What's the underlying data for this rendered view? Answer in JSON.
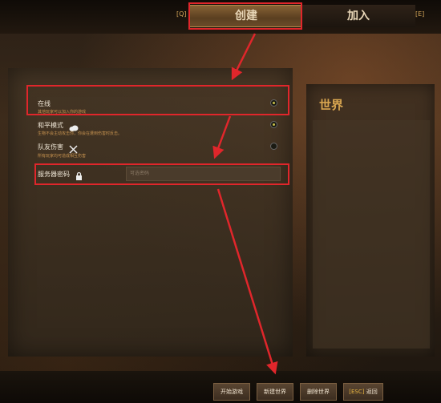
{
  "header": {
    "create_key": "[Q]",
    "join_key": "[E]",
    "tabs": [
      {
        "label": "创建",
        "active": true
      },
      {
        "label": "加入",
        "active": false
      }
    ]
  },
  "options": [
    {
      "label": "在线",
      "desc": "其他玩家可以加入你的游戏",
      "selected": true,
      "icon": ""
    },
    {
      "label": "和平模式",
      "desc": "生物不会主动攻击你，你会在遭到伤害时反击。",
      "selected": true,
      "icon": "cloud-icon"
    },
    {
      "label": "队友伤害",
      "desc": "所有玩家均可造成相互伤害",
      "selected": false,
      "icon": "crossed-swords-icon"
    }
  ],
  "password": {
    "label": "服务器密码",
    "icon": "lock-icon",
    "value": "可选密码"
  },
  "world_panel": {
    "title": "世界"
  },
  "bottom_buttons": [
    {
      "label": "开始游戏"
    },
    {
      "label": "新建世界"
    },
    {
      "label": "删除世界"
    },
    {
      "key": "[ESC]",
      "label": "返回"
    }
  ],
  "colors": {
    "annotation_red": "#e0262b",
    "accent_gold": "#d9a650"
  }
}
